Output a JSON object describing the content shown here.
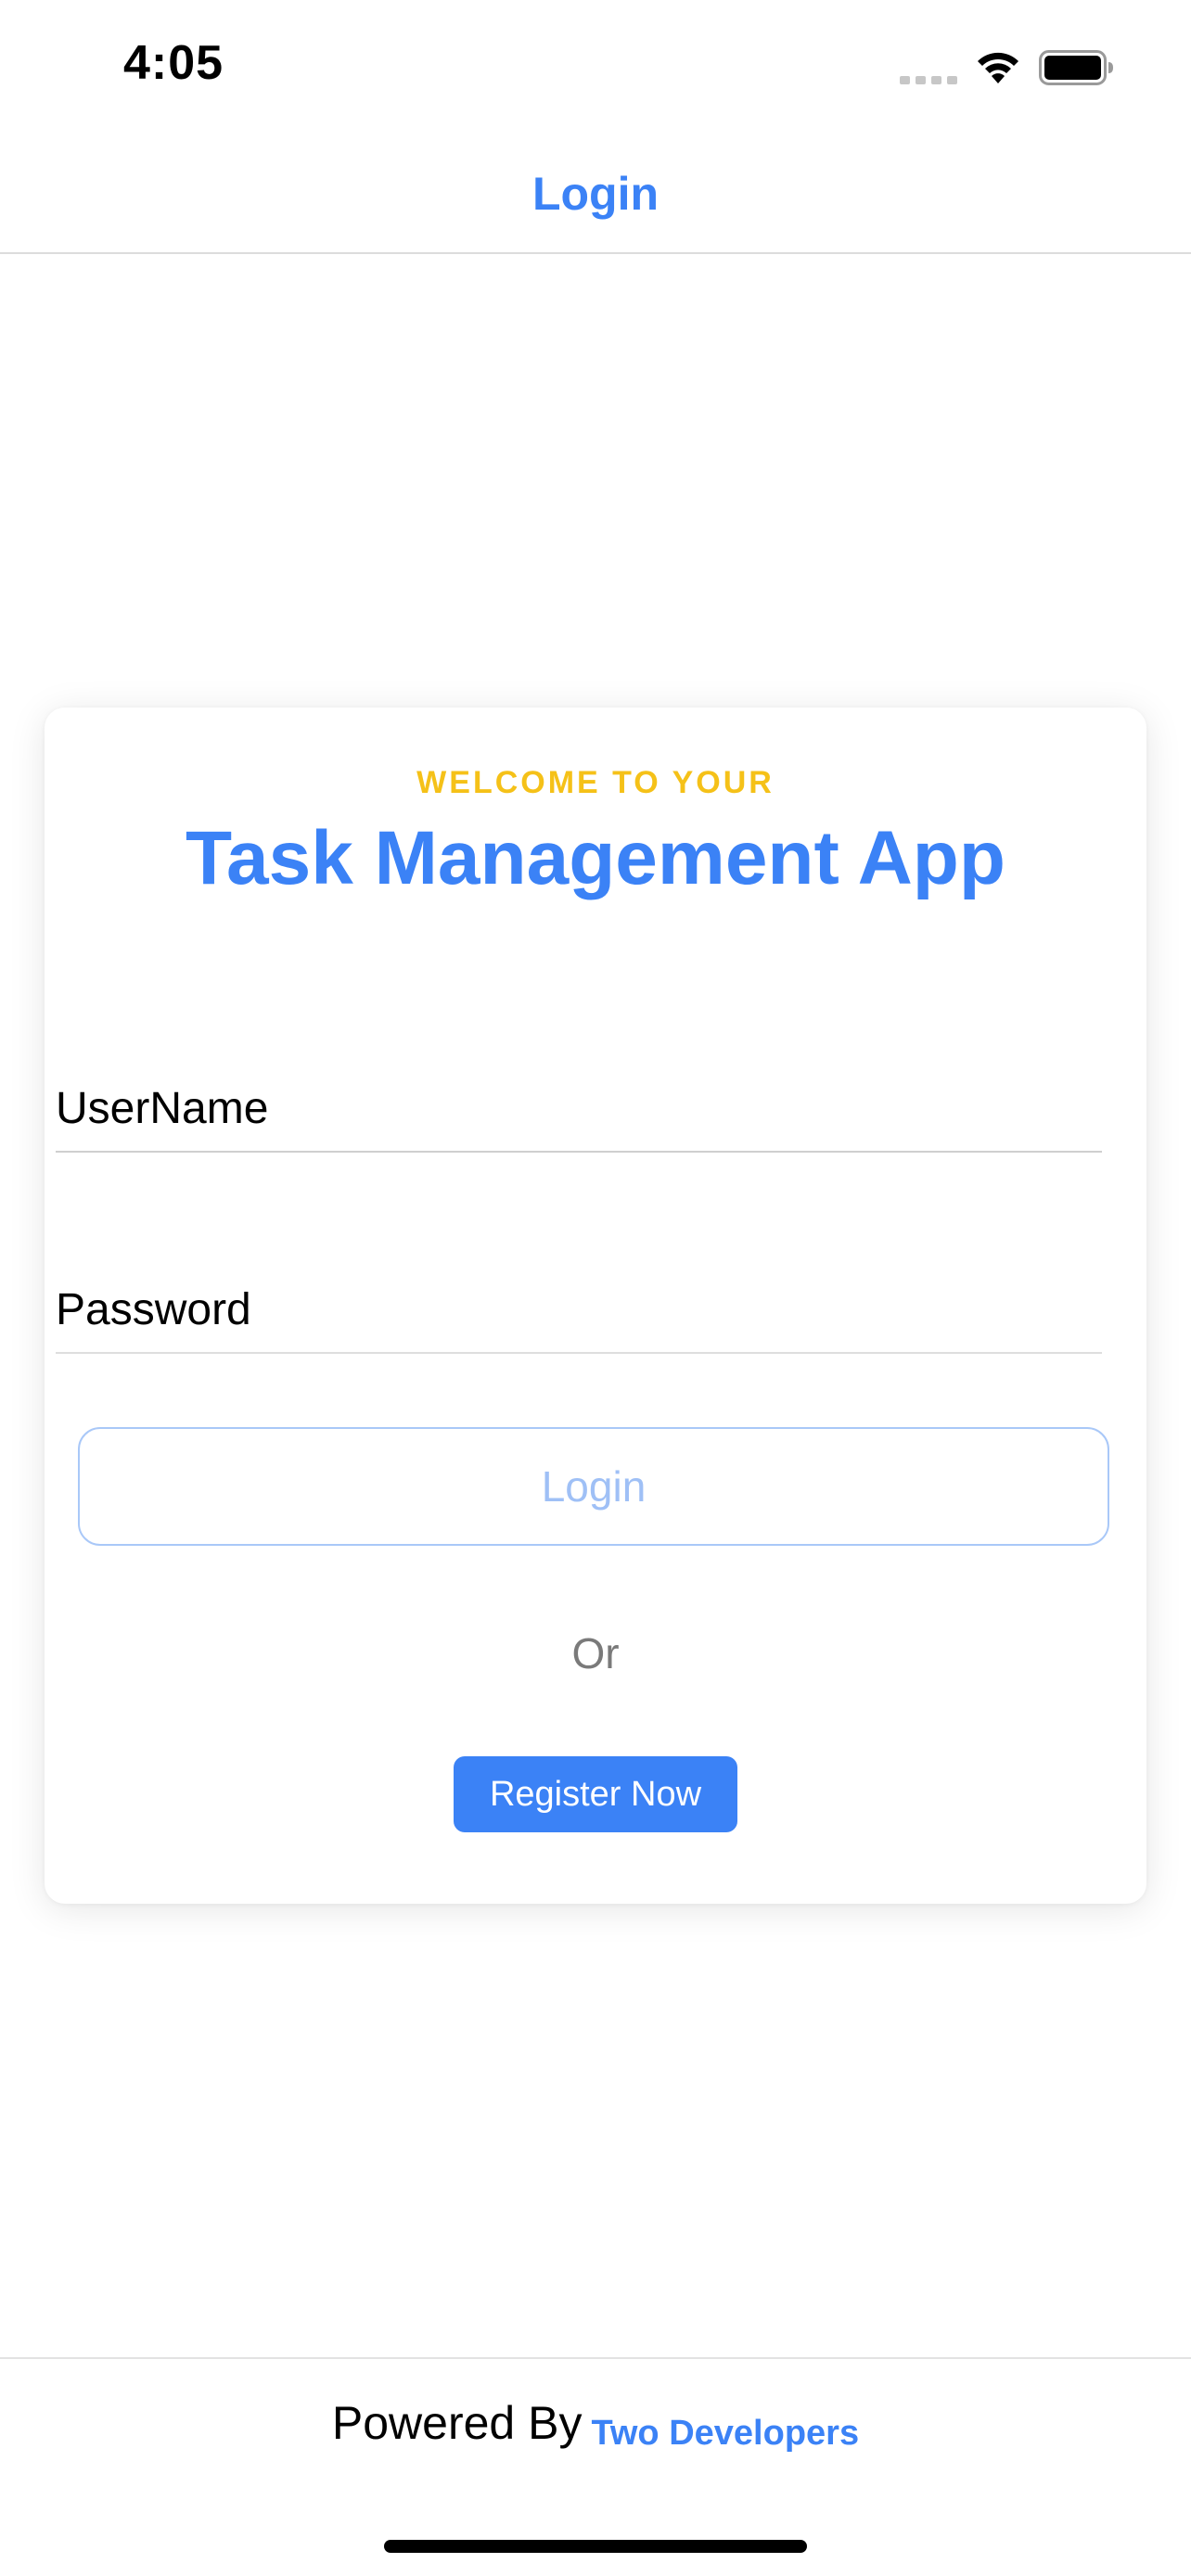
{
  "status_bar": {
    "time": "4:05",
    "icons": [
      "cellular-signal-icon",
      "wifi-icon",
      "battery-icon"
    ]
  },
  "nav": {
    "title": "Login"
  },
  "card": {
    "welcome": "WELCOME TO YOUR",
    "app_title": "Task Management App",
    "username_placeholder": "UserName",
    "password_placeholder": "Password",
    "login_label": "Login",
    "or_text": "Or",
    "register_label": "Register Now"
  },
  "footer": {
    "powered_label": "Powered By",
    "brand": "Two Developers"
  },
  "colors": {
    "accent": "#3b82f6",
    "welcome": "#f5c118",
    "login_disabled": "#9fc0f6"
  }
}
